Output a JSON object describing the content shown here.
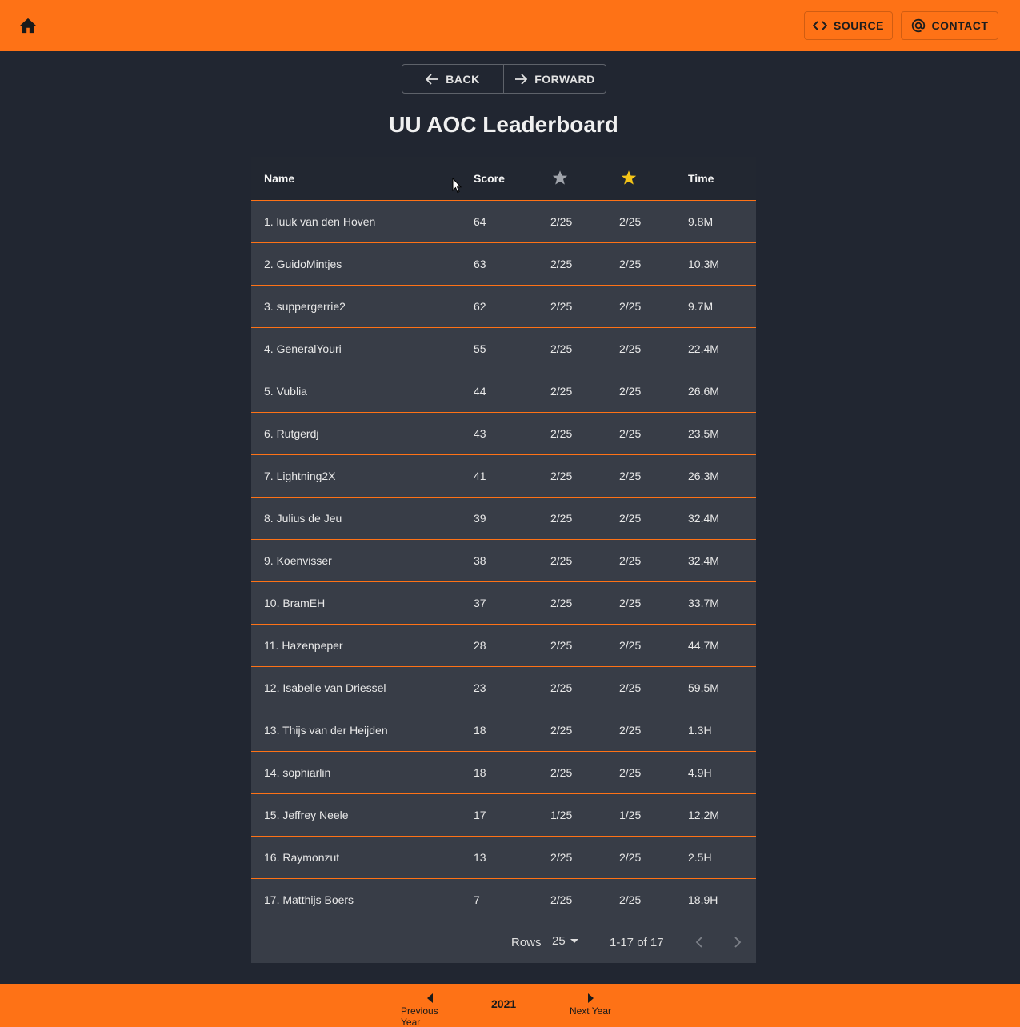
{
  "header": {
    "source_label": "SOURCE",
    "contact_label": "CONTACT"
  },
  "nav": {
    "back_label": "BACK",
    "forward_label": "FORWARD"
  },
  "title": "UU AOC Leaderboard",
  "table": {
    "columns": {
      "name": "Name",
      "score": "Score",
      "star_silver_icon": "star-silver-icon",
      "star_gold_icon": "star-gold-icon",
      "time": "Time"
    },
    "rows": [
      {
        "name": "1. luuk van den Hoven",
        "score": "64",
        "silver": "2/25",
        "gold": "2/25",
        "time": "9.8M"
      },
      {
        "name": "2. GuidoMintjes",
        "score": "63",
        "silver": "2/25",
        "gold": "2/25",
        "time": "10.3M"
      },
      {
        "name": "3. suppergerrie2",
        "score": "62",
        "silver": "2/25",
        "gold": "2/25",
        "time": "9.7M"
      },
      {
        "name": "4. GeneralYouri",
        "score": "55",
        "silver": "2/25",
        "gold": "2/25",
        "time": "22.4M"
      },
      {
        "name": "5. Vublia",
        "score": "44",
        "silver": "2/25",
        "gold": "2/25",
        "time": "26.6M"
      },
      {
        "name": "6. Rutgerdj",
        "score": "43",
        "silver": "2/25",
        "gold": "2/25",
        "time": "23.5M"
      },
      {
        "name": "7. Lightning2X",
        "score": "41",
        "silver": "2/25",
        "gold": "2/25",
        "time": "26.3M"
      },
      {
        "name": "8. Julius de Jeu",
        "score": "39",
        "silver": "2/25",
        "gold": "2/25",
        "time": "32.4M"
      },
      {
        "name": "9. Koenvisser",
        "score": "38",
        "silver": "2/25",
        "gold": "2/25",
        "time": "32.4M"
      },
      {
        "name": "10. BramEH",
        "score": "37",
        "silver": "2/25",
        "gold": "2/25",
        "time": "33.7M"
      },
      {
        "name": "11. Hazenpeper",
        "score": "28",
        "silver": "2/25",
        "gold": "2/25",
        "time": "44.7M"
      },
      {
        "name": "12. Isabelle van Driessel",
        "score": "23",
        "silver": "2/25",
        "gold": "2/25",
        "time": "59.5M"
      },
      {
        "name": "13. Thijs van der Heijden",
        "score": "18",
        "silver": "2/25",
        "gold": "2/25",
        "time": "1.3H"
      },
      {
        "name": "14. sophiarlin",
        "score": "18",
        "silver": "2/25",
        "gold": "2/25",
        "time": "4.9H"
      },
      {
        "name": "15. Jeffrey Neele",
        "score": "17",
        "silver": "1/25",
        "gold": "1/25",
        "time": "12.2M"
      },
      {
        "name": "16. Raymonzut",
        "score": "13",
        "silver": "2/25",
        "gold": "2/25",
        "time": "2.5H"
      },
      {
        "name": "17. Matthijs Boers",
        "score": "7",
        "silver": "2/25",
        "gold": "2/25",
        "time": "18.9H"
      }
    ]
  },
  "pagination": {
    "rows_label": "Rows",
    "rows_per_page": "25",
    "range": "1-17 of 17"
  },
  "footer": {
    "prev_year_label": "Previous Year",
    "year": "2021",
    "next_year_label": "Next Year"
  },
  "colors": {
    "accent": "#fe7216",
    "background": "#212631",
    "table_row": "#383d47",
    "gold_star": "#f5c518",
    "silver_star": "#a0a4ab"
  }
}
